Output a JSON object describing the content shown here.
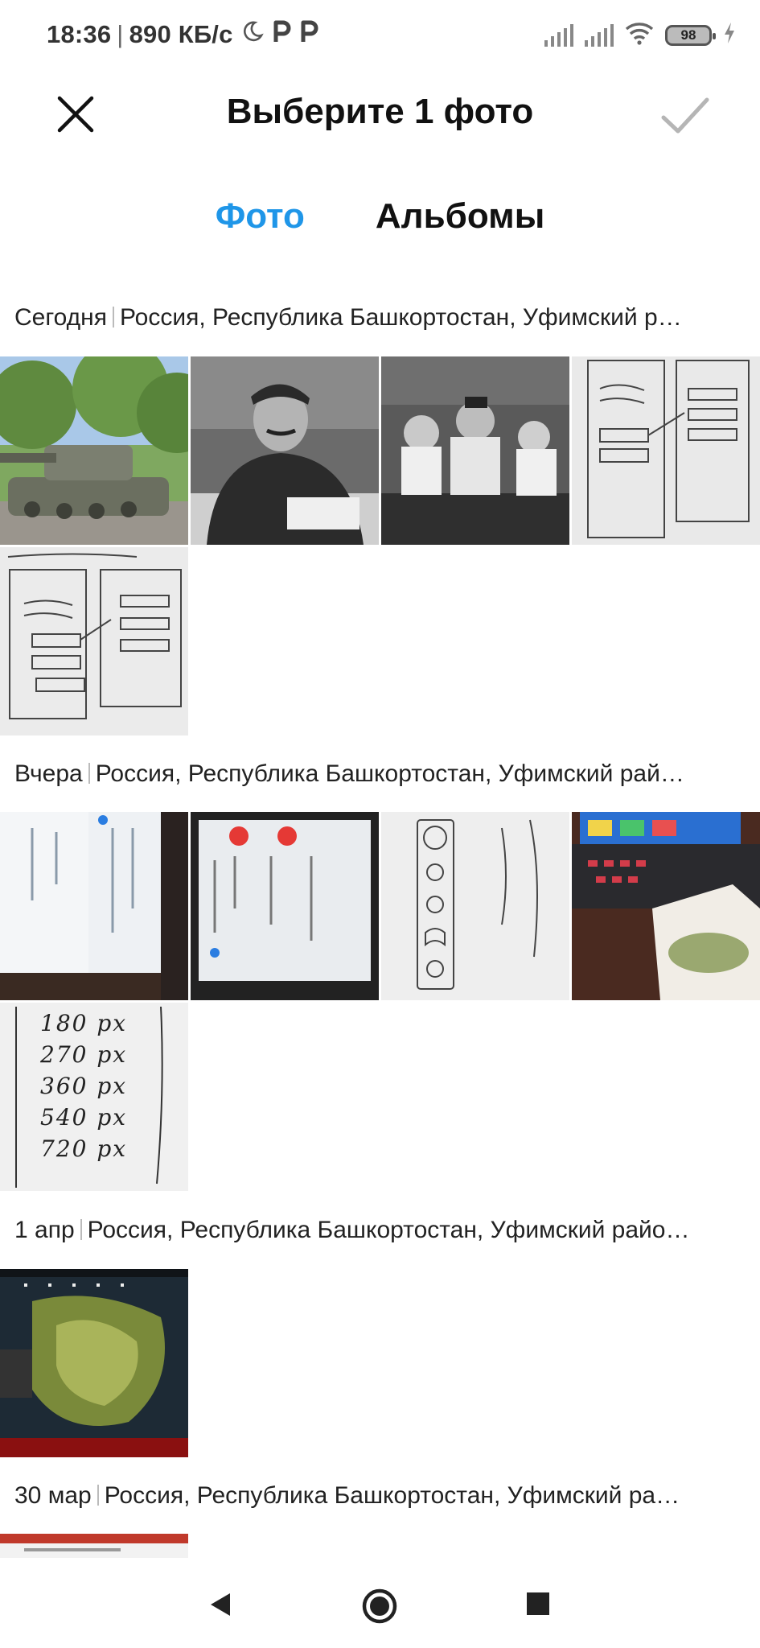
{
  "status_bar": {
    "time": "18:36",
    "speed": "890 КБ/с",
    "battery": "98"
  },
  "header": {
    "title": "Выберите 1 фото"
  },
  "tabs": [
    {
      "label": "Фото",
      "active": true
    },
    {
      "label": "Альбомы",
      "active": false
    }
  ],
  "sections": [
    {
      "date": "Сегодня",
      "location": "Россия, Республика Башкортостан, Уфимский р…"
    },
    {
      "date": "Вчера",
      "location": "Россия, Республика Башкортостан, Уфимский рай…"
    },
    {
      "date": "1 апр",
      "location": "Россия, Республика Башкортостан, Уфимский райо…"
    },
    {
      "date": "30 мар",
      "location": "Россия, Республика Башкортостан, Уфимский ра…"
    }
  ],
  "thumb_handwriting": {
    "prices": [
      "180 рх",
      "270 рх",
      "360 рх",
      "540 рх",
      "720 рх"
    ]
  },
  "colors": {
    "accent": "#1f96e8",
    "check_disabled": "#b5b5b5"
  }
}
